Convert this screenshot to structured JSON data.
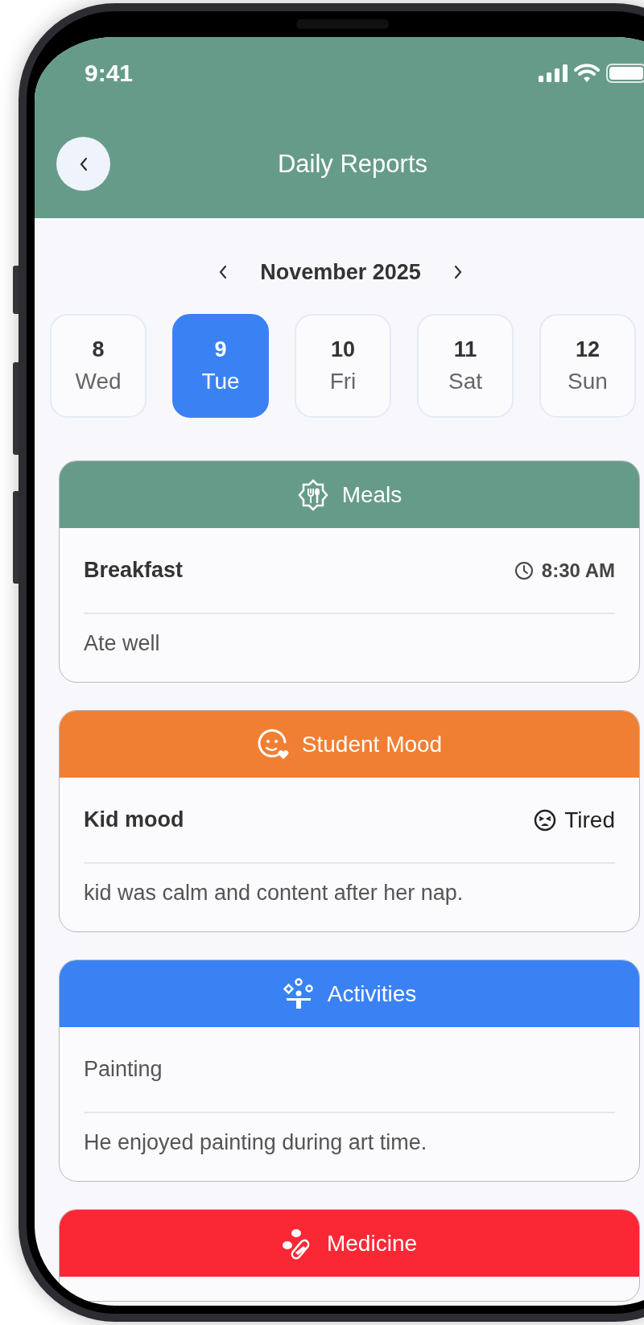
{
  "status_bar": {
    "time": "9:41"
  },
  "header": {
    "title": "Daily Reports"
  },
  "month_nav": {
    "label": "November 2025"
  },
  "days": [
    {
      "day": "8",
      "weekday": "Wed",
      "selected": false
    },
    {
      "day": "9",
      "weekday": "Tue",
      "selected": true
    },
    {
      "day": "10",
      "weekday": "Fri",
      "selected": false
    },
    {
      "day": "11",
      "weekday": "Sat",
      "selected": false
    },
    {
      "day": "12",
      "weekday": "Sun",
      "selected": false
    }
  ],
  "sections": [
    {
      "kind": "meals",
      "title": "Meals",
      "color": "#669b8a",
      "entry": {
        "label": "Breakfast",
        "emphasis": true,
        "meta": {
          "kind": "time",
          "text": "8:30 AM"
        },
        "note": "Ate well"
      }
    },
    {
      "kind": "mood",
      "title": "Student Mood",
      "color": "#f07f33",
      "entry": {
        "label": "Kid mood",
        "emphasis": true,
        "meta": {
          "kind": "tired",
          "text": "Tired"
        },
        "note": "kid was calm and content after her nap."
      }
    },
    {
      "kind": "activities",
      "title": "Activities",
      "color": "#3a82f4",
      "entry": {
        "label": "Painting",
        "emphasis": false,
        "note": "He enjoyed painting during art time."
      }
    },
    {
      "kind": "medicine",
      "title": "Medicine",
      "color": "#fa2835"
    }
  ]
}
